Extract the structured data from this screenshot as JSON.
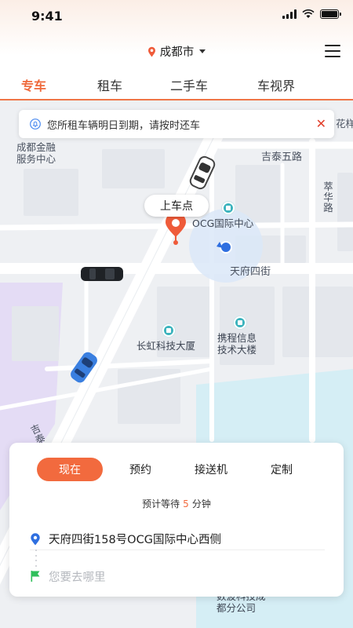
{
  "status_bar": {
    "time": "9:41"
  },
  "header": {
    "city": "成都市",
    "tabs": [
      {
        "label": "专车",
        "active": true
      },
      {
        "label": "租车",
        "active": false
      },
      {
        "label": "二手车",
        "active": false
      },
      {
        "label": "车视界",
        "active": false
      }
    ]
  },
  "notice": {
    "text": "您所租车辆明日到期，请按时还车"
  },
  "map": {
    "road_labels": {
      "jitai_5th_road": "吉泰五路",
      "tianfu_4th_street": "天府四街",
      "cuihua_road": "萃华路",
      "bottom_left_road": "吉泰"
    },
    "poi_labels": {
      "chengdu_finance_center": "成都金融\n服务中心",
      "ocg_center": "OCG国际中心",
      "changhong_building": "长虹科技大厦",
      "ctrip_building": "携程信息\n技术大楼",
      "partial_top_right": "花样",
      "partial_bottom": "数波科技成\n都分公司"
    },
    "pickup_label": "上车点",
    "colors": {
      "road_major": "#ffffff",
      "block": "#e4e7ec",
      "water": "#d5eef5",
      "purple_area": "#e4dcf5",
      "location_halo": "#dbe8f8",
      "pin": "#ef5b3a"
    }
  },
  "panel": {
    "modes": [
      {
        "label": "现在",
        "active": true
      },
      {
        "label": "预约",
        "active": false
      },
      {
        "label": "接送机",
        "active": false
      },
      {
        "label": "定制",
        "active": false
      }
    ],
    "wait_prefix": "预计等待",
    "wait_minutes": "5",
    "wait_suffix": "分钟",
    "from_address": "天府四街158号OCG国际中心西侧",
    "to_placeholder": "您要去哪里",
    "colors": {
      "accent": "#f26a3e",
      "from_pin": "#2f6fe0",
      "to_flag": "#2fbf5b"
    }
  }
}
